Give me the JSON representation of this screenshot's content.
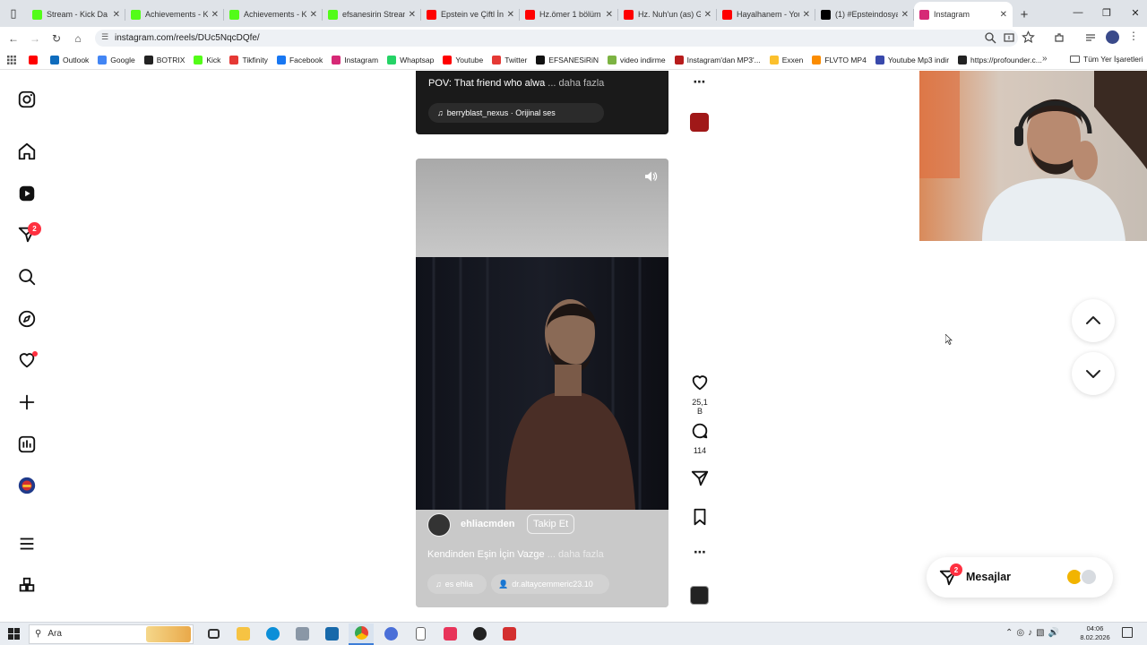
{
  "browser": {
    "tabs": [
      {
        "label": "Stream - Kick Da",
        "icon": "kick-icon",
        "color": "#53fc18"
      },
      {
        "label": "Achievements - K",
        "icon": "kick-icon",
        "color": "#53fc18"
      },
      {
        "label": "Achievements - K",
        "icon": "kick-icon",
        "color": "#53fc18"
      },
      {
        "label": "efsanesirin Stream",
        "icon": "kick-icon",
        "color": "#53fc18"
      },
      {
        "label": "Epstein ve Çiftl İn",
        "icon": "youtube-icon",
        "color": "#ff0000"
      },
      {
        "label": "Hz.ömer 1 bölüm",
        "icon": "youtube-icon",
        "color": "#ff0000"
      },
      {
        "label": "Hz. Nuh'un (as) G",
        "icon": "youtube-icon",
        "color": "#ff0000"
      },
      {
        "label": "Hayalhanem - You",
        "icon": "youtube-icon",
        "color": "#ff0000"
      },
      {
        "label": "(1) #Epsteindosya",
        "icon": "x-icon",
        "color": "#000000"
      },
      {
        "label": "Instagram",
        "icon": "instagram-icon",
        "color": "#d62976",
        "active": true
      }
    ],
    "url": "instagram.com/reels/DUc5NqcDQfe/",
    "bookmarks": [
      {
        "label": "",
        "color": "#ff0000"
      },
      {
        "label": "Outlook",
        "color": "#0f6cbd"
      },
      {
        "label": "Google",
        "color": "#4285f4"
      },
      {
        "label": "BOTRIX",
        "color": "#222222"
      },
      {
        "label": "Kick",
        "color": "#53fc18"
      },
      {
        "label": "Tikfinity",
        "color": "#e53935"
      },
      {
        "label": "Facebook",
        "color": "#1877f2"
      },
      {
        "label": "Instagram",
        "color": "#d62976"
      },
      {
        "label": "Whaptsap",
        "color": "#25d366"
      },
      {
        "label": "Youtube",
        "color": "#ff0000"
      },
      {
        "label": "Twitter",
        "color": "#e53935"
      },
      {
        "label": "EFSANESiRiN",
        "color": "#111111"
      },
      {
        "label": "video indirme",
        "color": "#7cb342"
      },
      {
        "label": "Instagram'dan MP3'...",
        "color": "#b71c1c"
      },
      {
        "label": "Exxen",
        "color": "#fbc02d"
      },
      {
        "label": "FLVTO MP4",
        "color": "#fb8c00"
      },
      {
        "label": "Youtube Mp3 indir",
        "color": "#3949ab"
      },
      {
        "label": "https://profounder.c...",
        "color": "#222222"
      }
    ],
    "more_bookmarks": "»",
    "all_bookmarks": "Tüm Yer İşaretleri"
  },
  "sidebar": {
    "notifications_count": "2"
  },
  "reel_top": {
    "caption": "POV: That friend who alwa",
    "more": "... daha fazla",
    "audio": "berryblast_nexus · Orijinal ses"
  },
  "reel_main": {
    "username": "ehliacmden",
    "follow_label": "Takip Et",
    "caption": "Kendinden Eşin İçin Vazge",
    "more": "... daha fazla",
    "audio_left": "es  ehlia",
    "audio_user": "dr.altaycemmeric23.10",
    "likes": "25,1 B",
    "comments": "114"
  },
  "messages": {
    "label": "Mesajlar",
    "count": "2"
  },
  "taskbar": {
    "search_label": "Ara",
    "time": "04:06",
    "date": "8.02.2026"
  },
  "colors": {
    "badge": "#ff3040",
    "chrome_frame": "#dfe3e8"
  }
}
